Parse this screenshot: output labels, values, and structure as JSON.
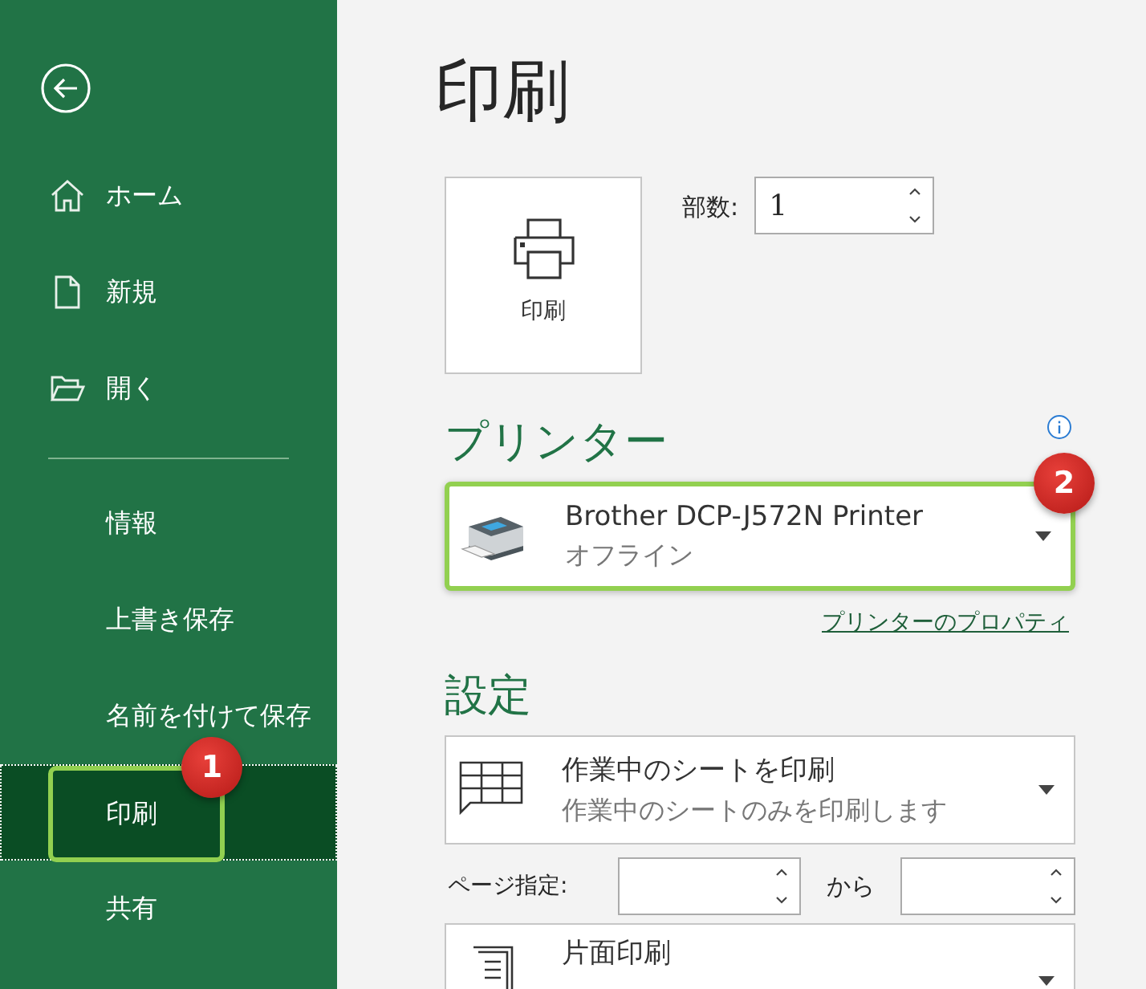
{
  "sidebar": {
    "back_button": {
      "kind": "back"
    },
    "items": [
      {
        "kind": "home",
        "label": "ホーム",
        "selected": false
      },
      {
        "kind": "new",
        "label": "新規",
        "selected": false
      },
      {
        "kind": "open",
        "label": "開く",
        "selected": false
      },
      {
        "kind": "divider"
      },
      {
        "kind": "text",
        "label": "情報",
        "selected": false
      },
      {
        "kind": "text",
        "label": "上書き保存",
        "selected": false
      },
      {
        "kind": "text",
        "label": "名前を付けて保存",
        "selected": false
      },
      {
        "kind": "text",
        "label": "印刷",
        "selected": true,
        "callout": "1"
      },
      {
        "kind": "text",
        "label": "共有",
        "selected": false
      }
    ]
  },
  "main": {
    "title": "印刷",
    "print_button": {
      "label": "印刷"
    },
    "copies": {
      "label": "部数:",
      "value": "1"
    },
    "printer": {
      "heading": "プリンター",
      "name": "Brother DCP-J572N Printer",
      "status": "オフライン",
      "callout": "2",
      "properties_link": "プリンターのプロパティ"
    },
    "settings": {
      "heading": "設定",
      "what": {
        "title": "作業中のシートを印刷",
        "subtitle": "作業中のシートのみを印刷します"
      },
      "pages": {
        "label": "ページ指定:",
        "separator": "から"
      },
      "sides": {
        "title": "片面印刷"
      }
    }
  }
}
